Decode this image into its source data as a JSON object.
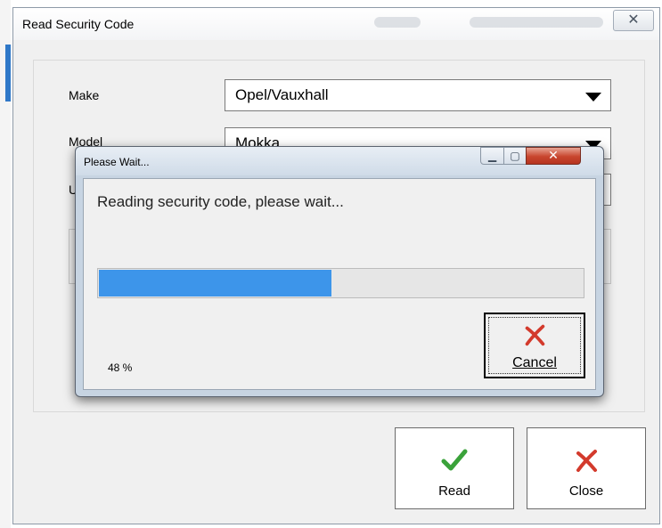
{
  "main_window": {
    "title": "Read Security Code",
    "close_glyph": "✕"
  },
  "form": {
    "make_label": "Make",
    "make_value": "Opel/Vauxhall",
    "model_label": "Model",
    "model_value": "Mokka",
    "third_label": "U"
  },
  "buttons": {
    "read_label": "Read",
    "close_label": "Close",
    "read_icon": "checkmark-icon",
    "close_icon": "red-x-icon"
  },
  "progress_dialog": {
    "title": "Please Wait...",
    "message": "Reading security code, please wait...",
    "percent_text": "48 %",
    "progress": 0.48,
    "cancel_label": "Cancel",
    "cancel_icon": "red-x-icon",
    "minimize_glyph": "▁",
    "maximize_glyph": "▢",
    "close_glyph": "✕"
  },
  "colors": {
    "progress_fill": "#3d95ea",
    "check_green": "#3aa23a",
    "x_red": "#d33a2c"
  }
}
